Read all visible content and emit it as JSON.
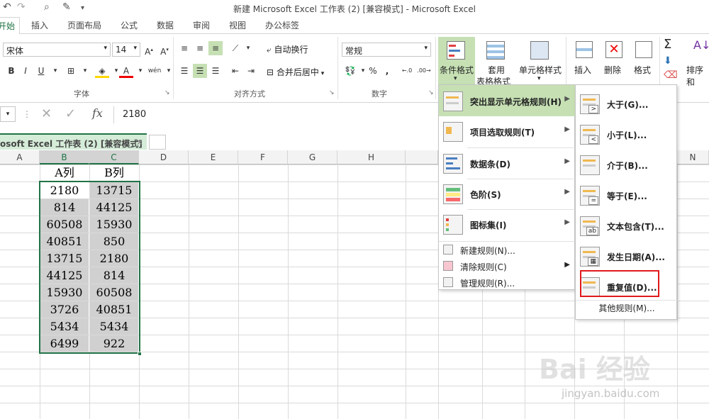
{
  "window": {
    "title": "新建 Microsoft Excel 工作表 (2)  [兼容模式] - Microsoft Excel"
  },
  "tabs": [
    "开始",
    "插入",
    "页面布局",
    "公式",
    "数据",
    "审阅",
    "视图",
    "办公标签"
  ],
  "ribbon": {
    "font_name": "宋体",
    "font_size": "14",
    "font_group": "字体",
    "align_group": "对齐方式",
    "number_group": "数字",
    "wrap_text": "自动换行",
    "merge_center": "合并后居中",
    "number_format": "常规",
    "conditional_format": "条件格式",
    "table_format": [
      "套用",
      "表格格式"
    ],
    "cell_style": "单元格样式",
    "insert": "插入",
    "delete": "删除",
    "format": "格式",
    "sort_filter": "排序和"
  },
  "formula_bar": {
    "value": "2180",
    "fx": "fx"
  },
  "sheet_tab": "osoft Excel 工作表 (2)  [兼容模式]",
  "columns": [
    "A",
    "B",
    "C",
    "D",
    "E",
    "F",
    "G",
    "H",
    "N"
  ],
  "table": {
    "headers": [
      "A列",
      "B列"
    ],
    "rows": [
      [
        "2180",
        "13715"
      ],
      [
        "814",
        "44125"
      ],
      [
        "60508",
        "15930"
      ],
      [
        "40851",
        "850"
      ],
      [
        "13715",
        "2180"
      ],
      [
        "44125",
        "814"
      ],
      [
        "15930",
        "60508"
      ],
      [
        "3726",
        "40851"
      ],
      [
        "5434",
        "5434"
      ],
      [
        "6499",
        "922"
      ]
    ]
  },
  "cf_menu": {
    "items": [
      {
        "label": "突出显示单元格规则(H)",
        "icon": "highlight-rules-icon"
      },
      {
        "label": "项目选取规则(T)",
        "icon": "top-bottom-rules-icon"
      },
      {
        "label": "数据条(D)",
        "icon": "data-bars-icon"
      },
      {
        "label": "色阶(S)",
        "icon": "color-scales-icon"
      },
      {
        "label": "图标集(I)",
        "icon": "icon-sets-icon"
      }
    ],
    "small_items": [
      "新建规则(N)...",
      "清除规则(C)",
      "管理规则(R)..."
    ]
  },
  "sub_menu": {
    "items": [
      "大于(G)...",
      "小于(L)...",
      "介于(B)...",
      "等于(E)...",
      "文本包含(T)...",
      "发生日期(A)...",
      "重复值(D)..."
    ],
    "more": "其他规则(M)..."
  },
  "watermark": {
    "brand": "Bai 经验",
    "url": "jingyan.baidu.com"
  },
  "colors": {
    "excel_green": "#217346",
    "highlight_green": "#c6e0b4",
    "red_box": "#e0191b"
  }
}
